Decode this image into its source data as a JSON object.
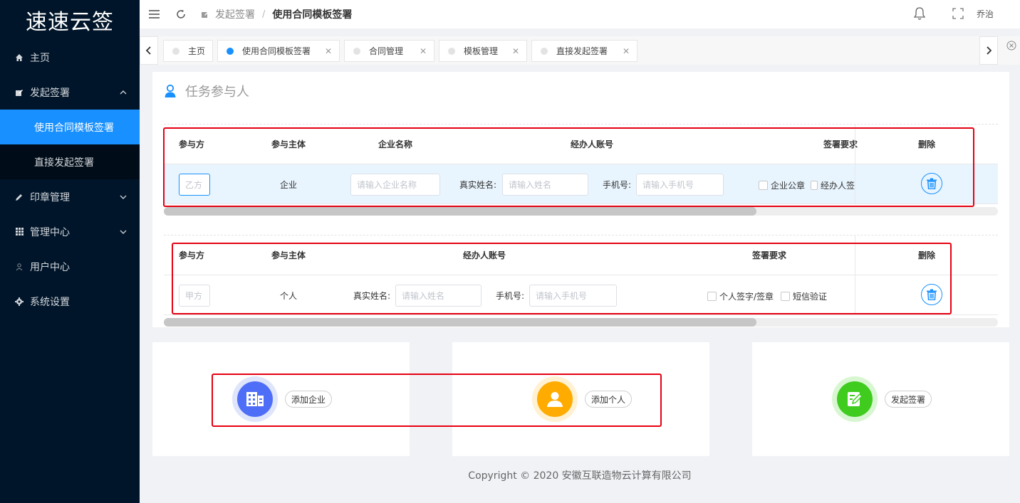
{
  "app": {
    "title": "速速云签"
  },
  "sidebar": {
    "items": [
      {
        "label": "主页"
      },
      {
        "label": "发起签署"
      },
      {
        "label": "印章管理"
      },
      {
        "label": "管理中心"
      },
      {
        "label": "用户中心"
      },
      {
        "label": "系统设置"
      }
    ],
    "sub_items": [
      {
        "label": "使用合同模板签署"
      },
      {
        "label": "直接发起签署"
      }
    ]
  },
  "header": {
    "breadcrumb": [
      "发起签署",
      "使用合同模板签署"
    ],
    "separator": "/",
    "user": "乔治"
  },
  "tabs": [
    {
      "label": "主页"
    },
    {
      "label": "使用合同模板签署"
    },
    {
      "label": "合同管理"
    },
    {
      "label": "模板管理"
    },
    {
      "label": "直接发起签署"
    }
  ],
  "section": {
    "title": "任务参与人"
  },
  "table1": {
    "headers": [
      "参与方",
      "参与主体",
      "企业名称",
      "经办人账号",
      "签署要求",
      "删除"
    ],
    "row": {
      "party_placeholder": "乙方",
      "subject": "企业",
      "company_placeholder": "请输入企业名称",
      "name_label": "真实姓名:",
      "name_placeholder": "请输入姓名",
      "phone_label": "手机号:",
      "phone_placeholder": "请输入手机号",
      "options": [
        "企业公章",
        "经办人签"
      ]
    }
  },
  "table2": {
    "headers": [
      "参与方",
      "参与主体",
      "经办人账号",
      "签署要求",
      "删除"
    ],
    "row": {
      "party_placeholder": "甲方",
      "subject": "个人",
      "name_label": "真实姓名:",
      "name_placeholder": "请输入姓名",
      "phone_label": "手机号:",
      "phone_placeholder": "请输入手机号",
      "options": [
        "个人签字/签章",
        "短信验证"
      ]
    }
  },
  "actions": [
    {
      "label": "添加企业",
      "color": "#4f6ef7",
      "ring": "#dfe5fb"
    },
    {
      "label": "添加个人",
      "color": "#ffab00",
      "ring": "#fff1d1"
    },
    {
      "label": "发起签署",
      "color": "#3fcc1f",
      "ring": "#d9f6d2"
    }
  ],
  "footer": {
    "text": "Copyright © 2020 安徽互联造物云计算有限公司"
  },
  "colors": {
    "primary": "#1890ff",
    "sidebar": "#001529",
    "highlight_box": "#e60012"
  }
}
